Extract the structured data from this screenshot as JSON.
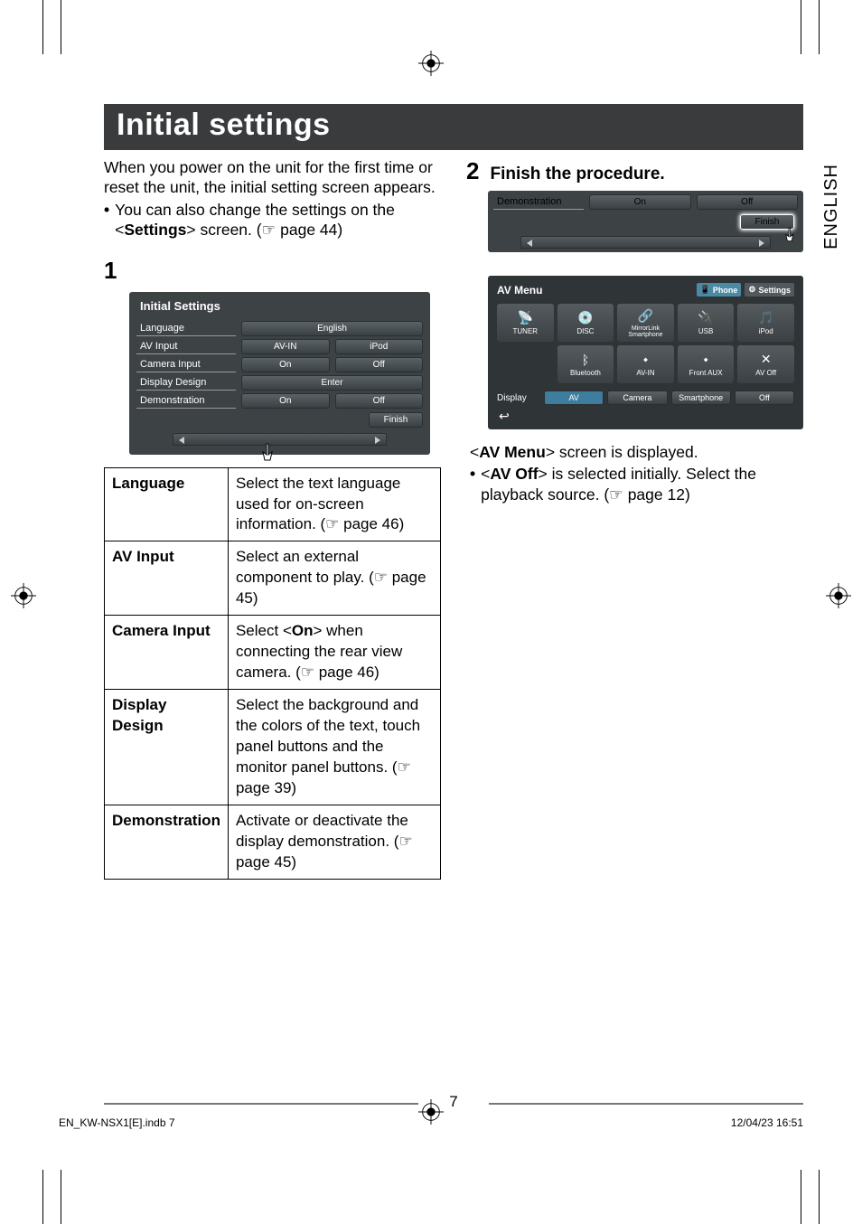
{
  "side_tab": "ENGLISH",
  "heading": "Initial settings",
  "intro": "When you power on the unit for the first time or reset the unit, the initial setting screen appears.",
  "intro_bullet_pre": "You can also change the settings on the <",
  "intro_bullet_bold": "Settings",
  "intro_bullet_post": "> screen. (☞ page 44)",
  "step1_num": "1",
  "initial_panel": {
    "title": "Initial Settings",
    "rows": [
      {
        "label": "Language",
        "opts": [
          "English"
        ]
      },
      {
        "label": "AV Input",
        "opts": [
          "AV-IN",
          "iPod"
        ]
      },
      {
        "label": "Camera Input",
        "opts": [
          "On",
          "Off"
        ]
      },
      {
        "label": "Display Design",
        "opts": [
          "Enter"
        ]
      },
      {
        "label": "Demonstration",
        "opts": [
          "On",
          "Off"
        ]
      }
    ],
    "finish": "Finish"
  },
  "table": {
    "rows": [
      {
        "key": "Language",
        "val": "Select the text language used for on-screen information. (☞ page 46)"
      },
      {
        "key": "AV Input",
        "val": "Select an external component to play. (☞ page 45)"
      },
      {
        "key": "Camera Input",
        "val_pre": "Select <",
        "val_bold": "On",
        "val_post": "> when connecting the rear view camera. (☞ page 46)"
      },
      {
        "key": "Display Design",
        "val": "Select the background and the colors of the text, touch panel buttons and the monitor panel buttons. (☞ page 39)"
      },
      {
        "key": "Demonstration",
        "val": "Activate or deactivate the display demonstration. (☞ page 45)"
      }
    ]
  },
  "step2_num": "2",
  "step2_title": "Finish the procedure.",
  "strip": {
    "label": "Demonstration",
    "opts": [
      "On",
      "Off"
    ],
    "finish": "Finish"
  },
  "avmenu": {
    "title": "AV Menu",
    "phone": "Phone",
    "settings": "Settings",
    "icons": [
      {
        "icon": "📡",
        "label": "TUNER"
      },
      {
        "icon": "💿",
        "label": "DISC"
      },
      {
        "icon": "🔗",
        "label": "MirrorLink Smartphone"
      },
      {
        "icon": "🔌",
        "label": "USB"
      },
      {
        "icon": "🎵",
        "label": "iPod"
      },
      {
        "icon": "ᛒ",
        "label": "Bluetooth"
      },
      {
        "icon": "⬩",
        "label": "AV-IN"
      },
      {
        "icon": "⬩",
        "label": "Front AUX"
      },
      {
        "icon": "✕",
        "label": "AV Off"
      },
      {
        "icon": "",
        "label": ""
      }
    ],
    "display_label": "Display",
    "display_opts": [
      "AV",
      "Camera",
      "Smartphone",
      "Off"
    ],
    "back": "↩"
  },
  "post_text_pre": "<",
  "post_text_bold": "AV Menu",
  "post_text_post": "> screen is displayed.",
  "post_bullet_pre": "<",
  "post_bullet_bold": "AV Off",
  "post_bullet_post": "> is selected initially. Select the playback source. (☞ page 12)",
  "page_number": "7",
  "footer_left": "EN_KW-NSX1[E].indb   7",
  "footer_right": "12/04/23   16:51"
}
